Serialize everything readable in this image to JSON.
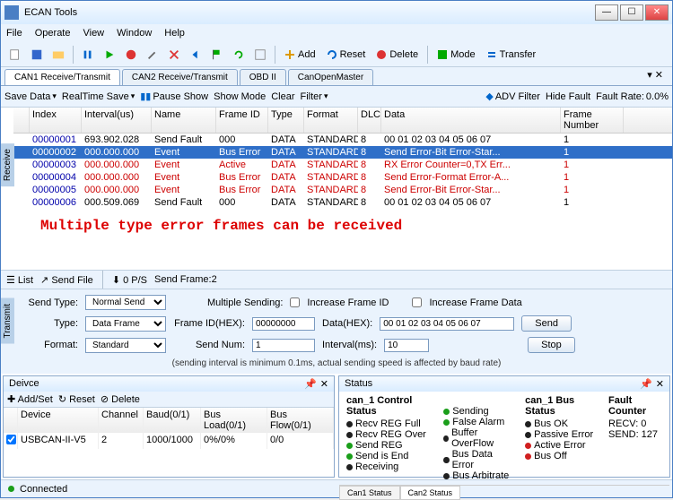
{
  "window": {
    "title": "ECAN Tools"
  },
  "menu": [
    "File",
    "Operate",
    "View",
    "Window",
    "Help"
  ],
  "toolbar_labeled": {
    "add": "Add",
    "reset": "Reset",
    "delete": "Delete",
    "mode": "Mode",
    "transfer": "Transfer"
  },
  "main_tabs": [
    "CAN1 Receive/Transmit",
    "CAN2 Receive/Transmit",
    "OBD II",
    "CanOpenMaster"
  ],
  "subbar": {
    "save_data": "Save Data",
    "realtime_save": "RealTime Save",
    "pause_show": "Pause Show",
    "show_mode": "Show Mode",
    "clear": "Clear",
    "filter": "Filter",
    "adv_filter": "ADV Filter",
    "hide_fault": "Hide Fault",
    "fault_rate_label": "Fault Rate:",
    "fault_rate_value": "0.0%"
  },
  "grid": {
    "headers": [
      "",
      "Index",
      "Interval(us)",
      "Name",
      "Frame ID",
      "Type",
      "Format",
      "DLC",
      "Data",
      "Frame Number"
    ],
    "rows": [
      {
        "idx": "00000001",
        "intv": "693.902.028",
        "name": "Send Fault",
        "fid": "000",
        "type": "DATA",
        "fmt": "STANDARD",
        "dlc": "8",
        "data": "00 01 02 03 04 05 06 07",
        "fn": "1",
        "cls": ""
      },
      {
        "idx": "00000002",
        "intv": "000.000.000",
        "name": "Event",
        "fid": "Bus Error",
        "type": "DATA",
        "fmt": "STANDARD",
        "dlc": "8",
        "data": "Send Error-Bit Error-Star...",
        "fn": "1",
        "cls": "sel"
      },
      {
        "idx": "00000003",
        "intv": "000.000.000",
        "name": "Event",
        "fid": "Active",
        "type": "DATA",
        "fmt": "STANDARD",
        "dlc": "8",
        "data": "RX Error Counter=0,TX Err...",
        "fn": "1",
        "cls": "err"
      },
      {
        "idx": "00000004",
        "intv": "000.000.000",
        "name": "Event",
        "fid": "Bus Error",
        "type": "DATA",
        "fmt": "STANDARD",
        "dlc": "8",
        "data": "Send Error-Format Error-A...",
        "fn": "1",
        "cls": "err"
      },
      {
        "idx": "00000005",
        "intv": "000.000.000",
        "name": "Event",
        "fid": "Bus Error",
        "type": "DATA",
        "fmt": "STANDARD",
        "dlc": "8",
        "data": "Send Error-Bit Error-Star...",
        "fn": "1",
        "cls": "err"
      },
      {
        "idx": "00000006",
        "intv": "000.509.069",
        "name": "Send Fault",
        "fid": "000",
        "type": "DATA",
        "fmt": "STANDARD",
        "dlc": "8",
        "data": "00 01 02 03 04 05 06 07",
        "fn": "1",
        "cls": ""
      }
    ],
    "banner": "Multiple type error frames can be received"
  },
  "sendbar": {
    "list": "List",
    "send_file": "Send File",
    "ps": "0 P/S",
    "send_frame": "Send Frame:2"
  },
  "sendform": {
    "send_type_label": "Send Type:",
    "send_type_value": "Normal Send",
    "multiple_sending": "Multiple Sending:",
    "inc_frame_id": "Increase Frame ID",
    "inc_frame_data": "Increase Frame Data",
    "type_label": "Type:",
    "type_value": "Data Frame",
    "frame_id_label": "Frame ID(HEX):",
    "frame_id_value": "00000000",
    "data_hex_label": "Data(HEX):",
    "data_hex_value": "00 01 02 03 04 05 06 07",
    "format_label": "Format:",
    "format_value": "Standard",
    "send_num_label": "Send Num:",
    "send_num_value": "1",
    "interval_label": "Interval(ms):",
    "interval_value": "10",
    "send_btn": "Send",
    "stop_btn": "Stop",
    "note": "(sending interval is minimum 0.1ms, actual sending speed is affected by baud rate)"
  },
  "device_panel": {
    "title": "Deivce",
    "bar": {
      "addset": "Add/Set",
      "reset": "Reset",
      "delete": "Delete"
    },
    "headers": [
      "",
      "Device",
      "Channel",
      "Baud(0/1)",
      "Bus Load(0/1)",
      "Bus Flow(0/1)"
    ],
    "row": {
      "device": "USBCAN-II-V5",
      "channel": "2",
      "baud": "1000/1000",
      "load": "0%/0%",
      "flow": "0/0"
    }
  },
  "status_panel": {
    "title": "Status",
    "control_status_title": "can_1 Control Status",
    "control_items": [
      {
        "label": "Recv REG Full",
        "color": "#000"
      },
      {
        "label": "Recv REG Over",
        "color": "#000"
      },
      {
        "label": "Send REG",
        "color": "#0a0"
      },
      {
        "label": "Send is End",
        "color": "#0a0"
      },
      {
        "label": "Receiving",
        "color": "#000"
      }
    ],
    "control_items2": [
      {
        "label": "Sending",
        "color": "#0a0"
      },
      {
        "label": "False Alarm",
        "color": "#0a0"
      },
      {
        "label": "Buffer OverFlow",
        "color": "#000"
      },
      {
        "label": "Bus Data Error",
        "color": "#000"
      },
      {
        "label": "Bus Arbitrate",
        "color": "#000"
      }
    ],
    "bus_status_title": "can_1 Bus Status",
    "bus_items": [
      {
        "label": "Bus OK",
        "color": "#000"
      },
      {
        "label": "Passive Error",
        "color": "#000"
      },
      {
        "label": "Active Error",
        "color": "#d00"
      },
      {
        "label": "Bus Off",
        "color": "#d00"
      }
    ],
    "fault_counter_title": "Fault Counter",
    "fault_recv_label": "RECV:",
    "fault_recv_value": "0",
    "fault_send_label": "SEND:",
    "fault_send_value": "127",
    "tabs": [
      "Can1 Status",
      "Can2 Status"
    ]
  },
  "side_tabs": {
    "receive": "Receive",
    "transmit": "Transmit"
  },
  "statusbar": {
    "connected": "Connected"
  },
  "colors": {
    "green": "#1a9e1a",
    "red": "#d02020",
    "black": "#202020"
  }
}
